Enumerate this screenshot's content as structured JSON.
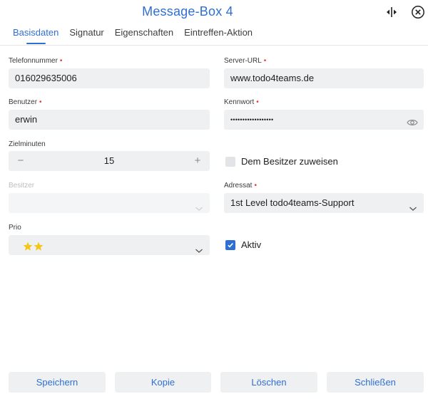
{
  "window": {
    "title": "Message-Box 4",
    "split_icon": "split-view-icon",
    "close_icon": "close-circle-icon"
  },
  "tabs": [
    {
      "label": "Basisdaten",
      "active": true
    },
    {
      "label": "Signatur",
      "active": false
    },
    {
      "label": "Eigenschaften",
      "active": false
    },
    {
      "label": "Eintreffen-Aktion",
      "active": false
    }
  ],
  "form": {
    "telefonnummer": {
      "label": "Telefonnummer",
      "required": "•",
      "value": "016029635006"
    },
    "server_url": {
      "label": "Server-URL",
      "required": "•",
      "value": "www.todo4teams.de"
    },
    "benutzer": {
      "label": "Benutzer",
      "required": "•",
      "value": "erwin"
    },
    "kennwort": {
      "label": "Kennwort",
      "required": "•",
      "value": "••••••••••••••••••",
      "icon": "eye-icon"
    },
    "zielminuten": {
      "label": "Zielminuten",
      "value": "15",
      "minus": "−",
      "plus": "+"
    },
    "dem_besitzer": {
      "label": "Dem Besitzer zuweisen",
      "checked": false
    },
    "besitzer": {
      "label": "Besitzer",
      "value": "",
      "disabled": true
    },
    "adressat": {
      "label": "Adressat",
      "required": "•",
      "value": "1st Level todo4teams-Support"
    },
    "prio": {
      "label": "Prio",
      "stars": 2
    },
    "aktiv": {
      "label": "Aktiv",
      "checked": true
    }
  },
  "buttons": {
    "speichern": "Speichern",
    "kopie": "Kopie",
    "loeschen": "Löschen",
    "schliessen": "Schließen"
  },
  "colors": {
    "accent": "#2f6fd3",
    "required": "#e53935",
    "field_bg": "#eef0f2",
    "star": "#f5c518"
  }
}
